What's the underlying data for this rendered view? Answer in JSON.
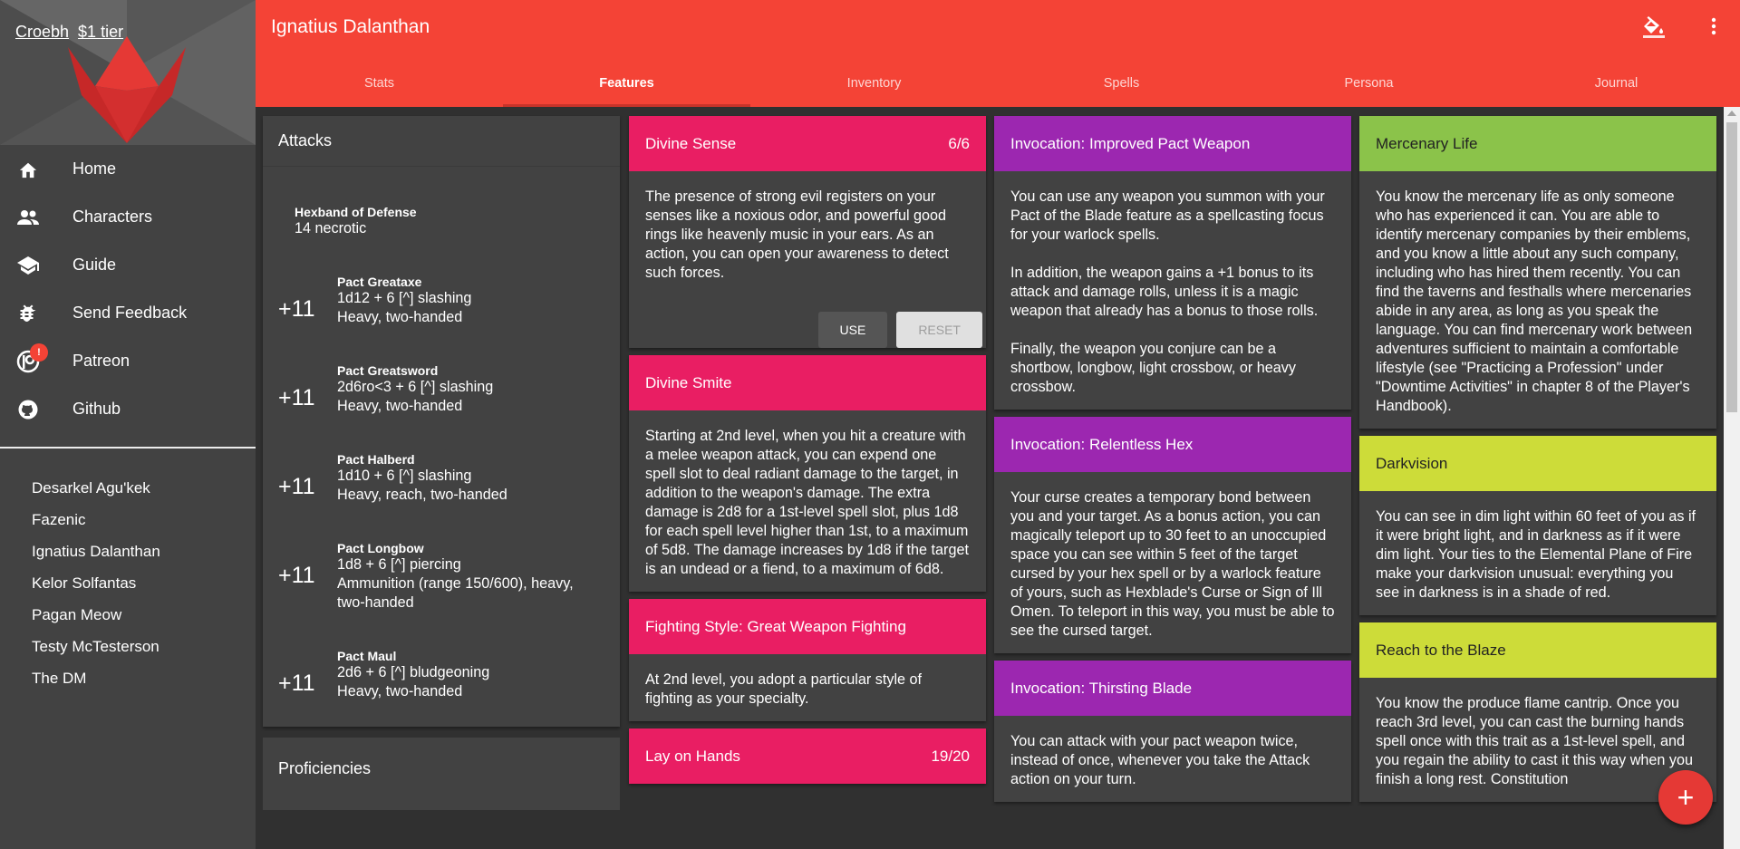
{
  "sidebar": {
    "user": "Croebh",
    "tier": "$1 tier",
    "nav": [
      {
        "label": "Home",
        "icon": "home-icon"
      },
      {
        "label": "Characters",
        "icon": "people-icon"
      },
      {
        "label": "Guide",
        "icon": "school-icon"
      },
      {
        "label": "Send Feedback",
        "icon": "bug-icon"
      },
      {
        "label": "Patreon",
        "icon": "patreon-icon",
        "badge": "!"
      },
      {
        "label": "Github",
        "icon": "github-icon"
      }
    ],
    "characters": [
      "Desarkel Agu'kek",
      "Fazenic",
      "Ignatius Dalanthan",
      "Kelor Solfantas",
      "Pagan Meow",
      "Testy McTesterson",
      "The DM"
    ]
  },
  "header": {
    "title": "Ignatius Dalanthan",
    "tabs": [
      "Stats",
      "Features",
      "Inventory",
      "Spells",
      "Persona",
      "Journal"
    ],
    "active_tab": "Features",
    "accent": "#f44336"
  },
  "attacks": {
    "title": "Attacks",
    "items": [
      {
        "bonus": "",
        "name": "Hexband of Defense",
        "lines": [
          "14 necrotic"
        ]
      },
      {
        "bonus": "+11",
        "name": "Pact Greataxe",
        "lines": [
          "1d12 + 6 [^] slashing",
          "Heavy, two-handed"
        ]
      },
      {
        "bonus": "+11",
        "name": "Pact Greatsword",
        "lines": [
          "2d6ro<3 + 6 [^] slashing",
          "Heavy, two-handed"
        ]
      },
      {
        "bonus": "+11",
        "name": "Pact Halberd",
        "lines": [
          "1d10 + 6 [^] slashing",
          "Heavy, reach, two-handed"
        ]
      },
      {
        "bonus": "+11",
        "name": "Pact Longbow",
        "lines": [
          "1d8 + 6 [^] piercing",
          "Ammunition (range 150/600), heavy,",
          "two-handed"
        ]
      },
      {
        "bonus": "+11",
        "name": "Pact Maul",
        "lines": [
          "2d6 + 6 [^] bludgeoning",
          "Heavy, two-handed"
        ]
      }
    ],
    "proficiencies_title": "Proficiencies"
  },
  "features": {
    "col2": [
      {
        "color": "pink",
        "title": "Divine Sense",
        "counter": "6/6",
        "paragraphs": [
          "The presence of strong evil registers on your senses like a noxious odor, and powerful good rings like heavenly music in your ears. As an action, you can open your awareness to detect such forces."
        ],
        "actions": {
          "use": "USE",
          "reset": "RESET"
        }
      },
      {
        "color": "pink",
        "title": "Divine Smite",
        "counter": "",
        "paragraphs": [
          "Starting at 2nd level, when you hit a creature with a melee weapon attack, you can expend one spell slot to deal radiant damage to the target, in addition to the weapon's damage. The extra damage is 2d8 for a 1st-level spell slot, plus 1d8 for each spell level higher than 1st, to a maximum of 5d8. The damage increases by 1d8 if the target is an undead or a fiend, to a maximum of 6d8."
        ]
      },
      {
        "color": "pink",
        "title": "Fighting Style: Great Weapon Fighting",
        "counter": "",
        "paragraphs": [
          "At 2nd level, you adopt a particular style of fighting as your specialty."
        ]
      },
      {
        "color": "pink",
        "title": "Lay on Hands",
        "counter": "19/20",
        "paragraphs": []
      }
    ],
    "col3": [
      {
        "color": "purple",
        "title": "Invocation: Improved Pact Weapon",
        "counter": "",
        "paragraphs": [
          "You can use any weapon you summon with your Pact of the Blade feature as a spellcasting focus for your warlock spells.",
          "In addition, the weapon gains a +1 bonus to its attack and damage rolls, unless it is a magic weapon that already has a bonus to those rolls.",
          "Finally, the weapon you conjure can be a shortbow, longbow, light crossbow, or heavy crossbow."
        ]
      },
      {
        "color": "purple",
        "title": "Invocation: Relentless Hex",
        "counter": "",
        "paragraphs": [
          "Your curse creates a temporary bond between you and your target. As a bonus action, you can magically teleport up to 30 feet to an unoccupied space you can see within 5 feet of the target cursed by your hex spell or by a warlock feature of yours, such as Hexblade's Curse or Sign of Ill Omen. To teleport in this way, you must be able to see the cursed target."
        ]
      },
      {
        "color": "purple",
        "title": "Invocation: Thirsting Blade",
        "counter": "",
        "paragraphs": [
          "You can attack with your pact weapon twice, instead of once, whenever you take the Attack action on your turn."
        ]
      }
    ],
    "col4": [
      {
        "color": "green",
        "title": "Mercenary Life",
        "counter": "",
        "paragraphs": [
          "You know the mercenary life as only someone who has experienced it can. You are able to identify mercenary companies by their emblems, and you know a little about any such company, including who has hired them recently. You can find the taverns and festhalls where mercenaries abide in any area, as long as you speak the language. You can find mercenary work between adventures sufficient to maintain a comfortable lifestyle (see \"Practicing a Profession\" under \"Downtime Activities\" in chapter 8 of the Player's Handbook)."
        ]
      },
      {
        "color": "lime",
        "title": "Darkvision",
        "counter": "",
        "paragraphs": [
          "You can see in dim light within 60 feet of you as if it were bright light, and in darkness as if it were dim light. Your ties to the Elemental Plane of Fire make your darkvision unusual: everything you see in darkness is in a shade of red."
        ]
      },
      {
        "color": "lime",
        "title": "Reach to the Blaze",
        "counter": "",
        "paragraphs": [
          "You know the produce flame cantrip. Once you reach 3rd level, you can cast the burning hands spell once with this trait as a 1st-level spell, and you regain the ability to cast it this way when you finish a long rest. Constitution"
        ]
      }
    ]
  },
  "fab": {
    "label": "+"
  }
}
